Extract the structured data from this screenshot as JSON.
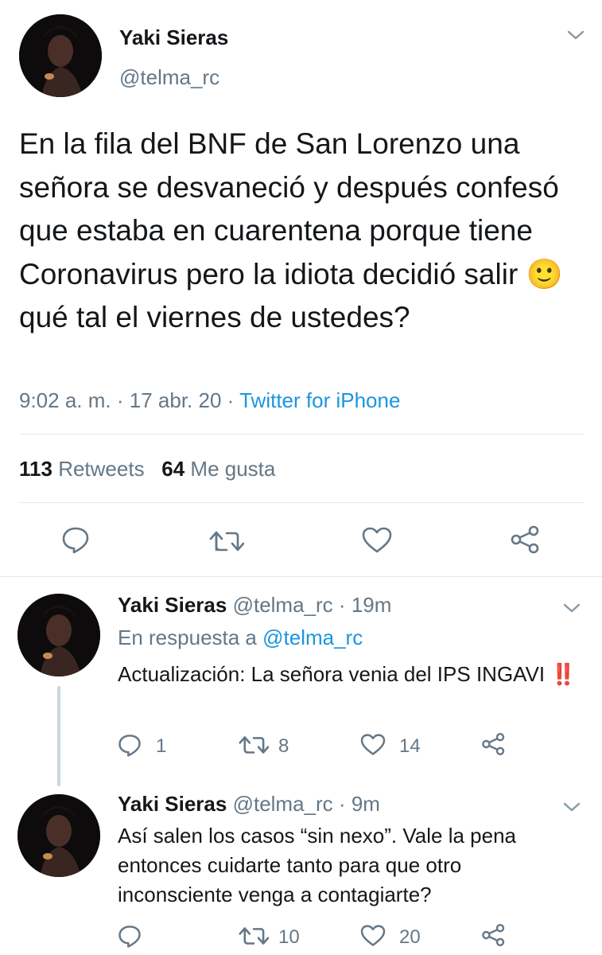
{
  "main_tweet": {
    "author_name": "Yaki Sieras",
    "handle": "@telma_rc",
    "text_before_emoji": "En la fila del BNF de San Lorenzo una señora se desvaneció y después confesó que estaba en cuarentena porque tiene Coronavirus pero la idiota decidió salir",
    "emoji": "🙂",
    "text_after_emoji": "qué tal el viernes de ustedes?",
    "time": "9:02 a. m.",
    "sep1": "·",
    "date": "17 abr. 20",
    "sep2": "·",
    "source": "Twitter for iPhone",
    "retweets_count": "113",
    "retweets_label": "Retweets",
    "likes_count": "64",
    "likes_label": "Me gusta"
  },
  "replies": [
    {
      "author_name": "Yaki Sieras",
      "handle": "@telma_rc",
      "sep": "·",
      "time_ago": "19m",
      "replying_to_label": "En respuesta a",
      "replying_to_handle": "@telma_rc",
      "text": "Actualización: La señora venia del IPS INGAVI",
      "emoji": "‼️",
      "reply_count": "1",
      "retweet_count": "8",
      "like_count": "14"
    },
    {
      "author_name": "Yaki Sieras",
      "handle": "@telma_rc",
      "sep": "·",
      "time_ago": "9m",
      "text_line1": "Así salen los casos “sin nexo”. Vale la pena",
      "text_line2": "entonces cuidarte tanto para que otro",
      "text_line3": "inconsciente venga a contagiarte?",
      "reply_count": "",
      "retweet_count": "10",
      "like_count": "20"
    }
  ],
  "colors": {
    "primary_text": "#14171a",
    "secondary_text": "#657786",
    "link": "#1b95e0",
    "divider": "#e1e8ed",
    "thread_line": "#ccd6dd"
  },
  "icons": [
    "chevron-down-icon",
    "reply-icon",
    "retweet-icon",
    "like-icon",
    "share-icon"
  ]
}
